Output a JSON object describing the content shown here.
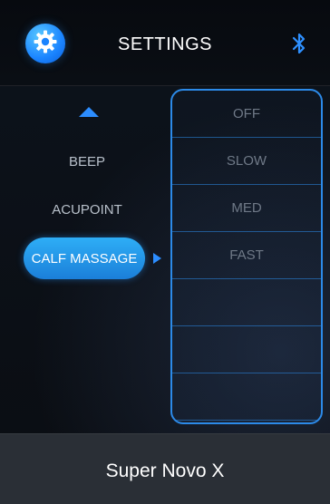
{
  "header": {
    "title": "SETTINGS",
    "left_icon": "gear-icon",
    "right_icon": "bluetooth-icon"
  },
  "menu": {
    "items": [
      {
        "label": "BEEP",
        "selected": false
      },
      {
        "label": "ACUPOINT",
        "selected": false
      },
      {
        "label": "CALF MASSAGE",
        "selected": true
      }
    ],
    "scroll_up_icon": "triangle-up-icon",
    "selection_indicator_icon": "triangle-right-icon"
  },
  "options": {
    "items": [
      "OFF",
      "SLOW",
      "MED",
      "FAST"
    ]
  },
  "footer": {
    "device_name": "Super Novo X"
  },
  "colors": {
    "accent": "#2c8ae8",
    "selected_pill": "#1e8fe6",
    "footer_bg": "#2a2f36"
  }
}
